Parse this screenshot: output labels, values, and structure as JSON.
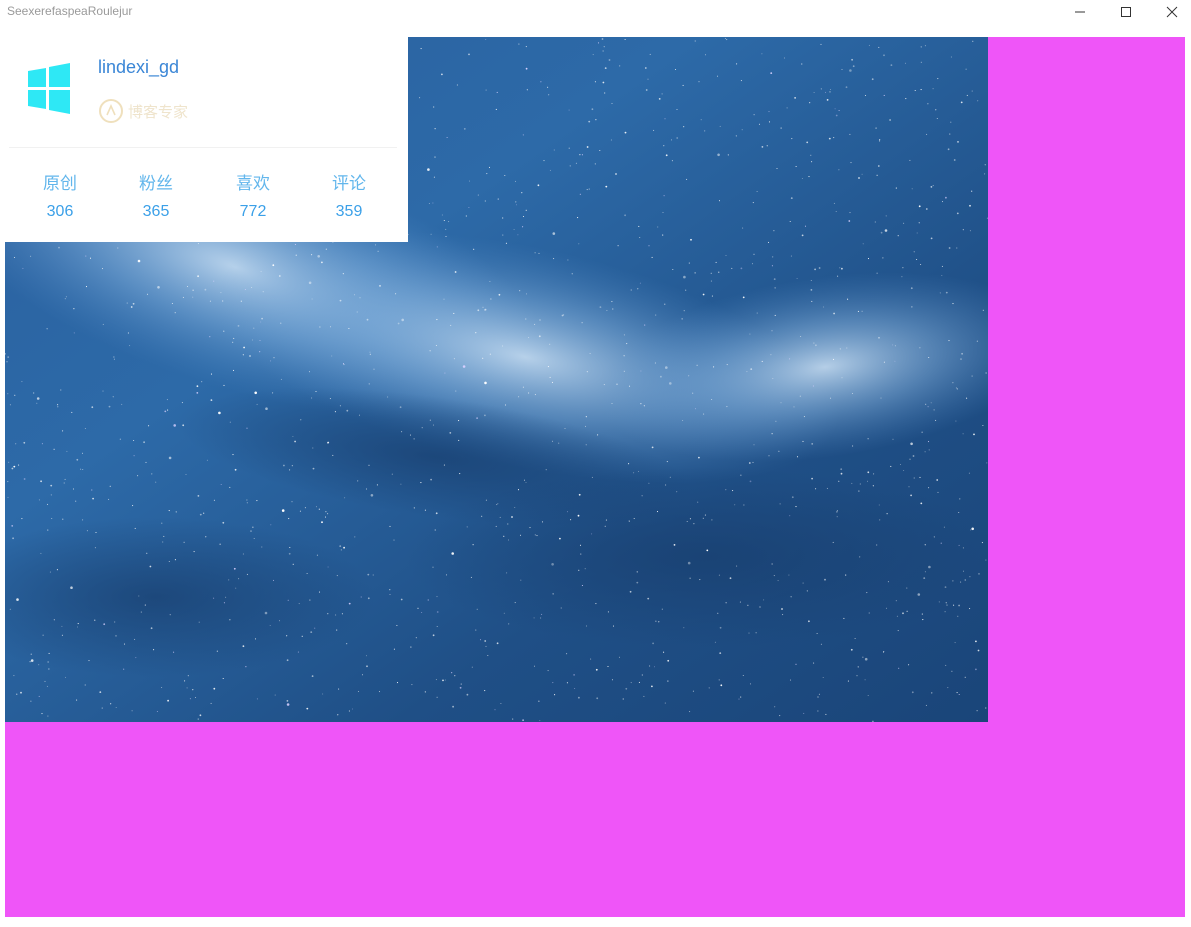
{
  "window": {
    "title": "SeexerefaspeaRoulejur",
    "controls": {
      "minimize_icon": "minimize-icon",
      "maximize_icon": "maximize-icon",
      "close_icon": "close-icon"
    }
  },
  "colors": {
    "client_background": "#ef55f8",
    "username": "#3a86d6",
    "stat_label": "#62b6ec",
    "stat_value": "#3ba0e8",
    "logo": "#2ee8f5"
  },
  "profile": {
    "username": "lindexi_gd",
    "badge_text": "博客专家",
    "badge_icon": "expert-badge-icon",
    "logo_icon": "windows-logo-icon",
    "stats": [
      {
        "label": "原创",
        "value": "306"
      },
      {
        "label": "粉丝",
        "value": "365"
      },
      {
        "label": "喜欢",
        "value": "772"
      },
      {
        "label": "评论",
        "value": "359"
      }
    ]
  },
  "background_image": {
    "description_icon": "milky-way-image"
  }
}
